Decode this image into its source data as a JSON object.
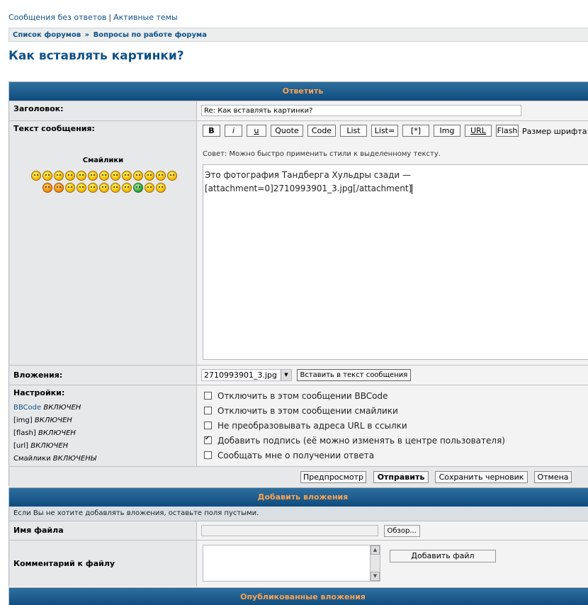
{
  "top_links": {
    "unanswered": "Сообщения без ответов",
    "separator": "|",
    "active": "Активные темы"
  },
  "breadcrumb": {
    "forums": "Список форумов",
    "raquo": "»",
    "section": "Вопросы по работе форума"
  },
  "page_title": "Как вставлять картинки?",
  "reply": {
    "header": "Ответить",
    "subject_label": "Заголовок:",
    "subject_value": "Re: Как вставлять картинки?",
    "text_label": "Текст сообщения:",
    "smilies_title": "Смайлики",
    "bbcode_buttons": [
      "B",
      "i",
      "u",
      "Quote",
      "Code",
      "List",
      "List=",
      "[*]",
      "Img",
      "URL",
      "Flash"
    ],
    "font_size_label": "Размер шрифта:",
    "tip": "Совет: Можно быстро применить стили к выделенному тексту.",
    "message_line1": "Это фотография Тандберга Хульдры сзади —",
    "message_line2": "[attachment=0]2710993901_3.jpg[/attachment]",
    "attachments_label": "Вложения:",
    "attachment_selected": "2710993901_3.jpg",
    "insert_button": "Вставить в текст сообщения",
    "settings_label": "Настройки:",
    "settings": [
      {
        "name": "BBCode",
        "state": "ВКЛЮЧЕН"
      },
      {
        "name": "[img]",
        "state": "ВКЛЮЧЕН"
      },
      {
        "name": "[flash]",
        "state": "ВКЛЮЧЕН"
      },
      {
        "name": "[url]",
        "state": "ВКЛЮЧЕН"
      },
      {
        "name": "Смайлики",
        "state": "ВКЛЮЧЕНЫ"
      }
    ],
    "options": [
      {
        "label": "Отключить в этом сообщении BBCode",
        "checked": false
      },
      {
        "label": "Отключить в этом сообщении смайлики",
        "checked": false
      },
      {
        "label": "Не преобразовывать адреса URL в ссылки",
        "checked": false
      },
      {
        "label": "Добавить подпись (её можно изменять в центре пользователя)",
        "checked": true
      },
      {
        "label": "Сообщать мне о получении ответа",
        "checked": false
      }
    ],
    "preview": "Предпросмотр",
    "submit": "Отправить",
    "save_draft": "Сохранить черновик",
    "cancel": "Отмена"
  },
  "add_attachments": {
    "header": "Добавить вложения",
    "notice": "Если Вы не хотите добавлять вложения, оставьте поля пустыми.",
    "filename_label": "Имя файла",
    "browse": "Обзор...",
    "comment_label": "Комментарий к файлу",
    "add_file": "Добавить файл"
  },
  "published": {
    "header": "Опубликованные вложения"
  }
}
